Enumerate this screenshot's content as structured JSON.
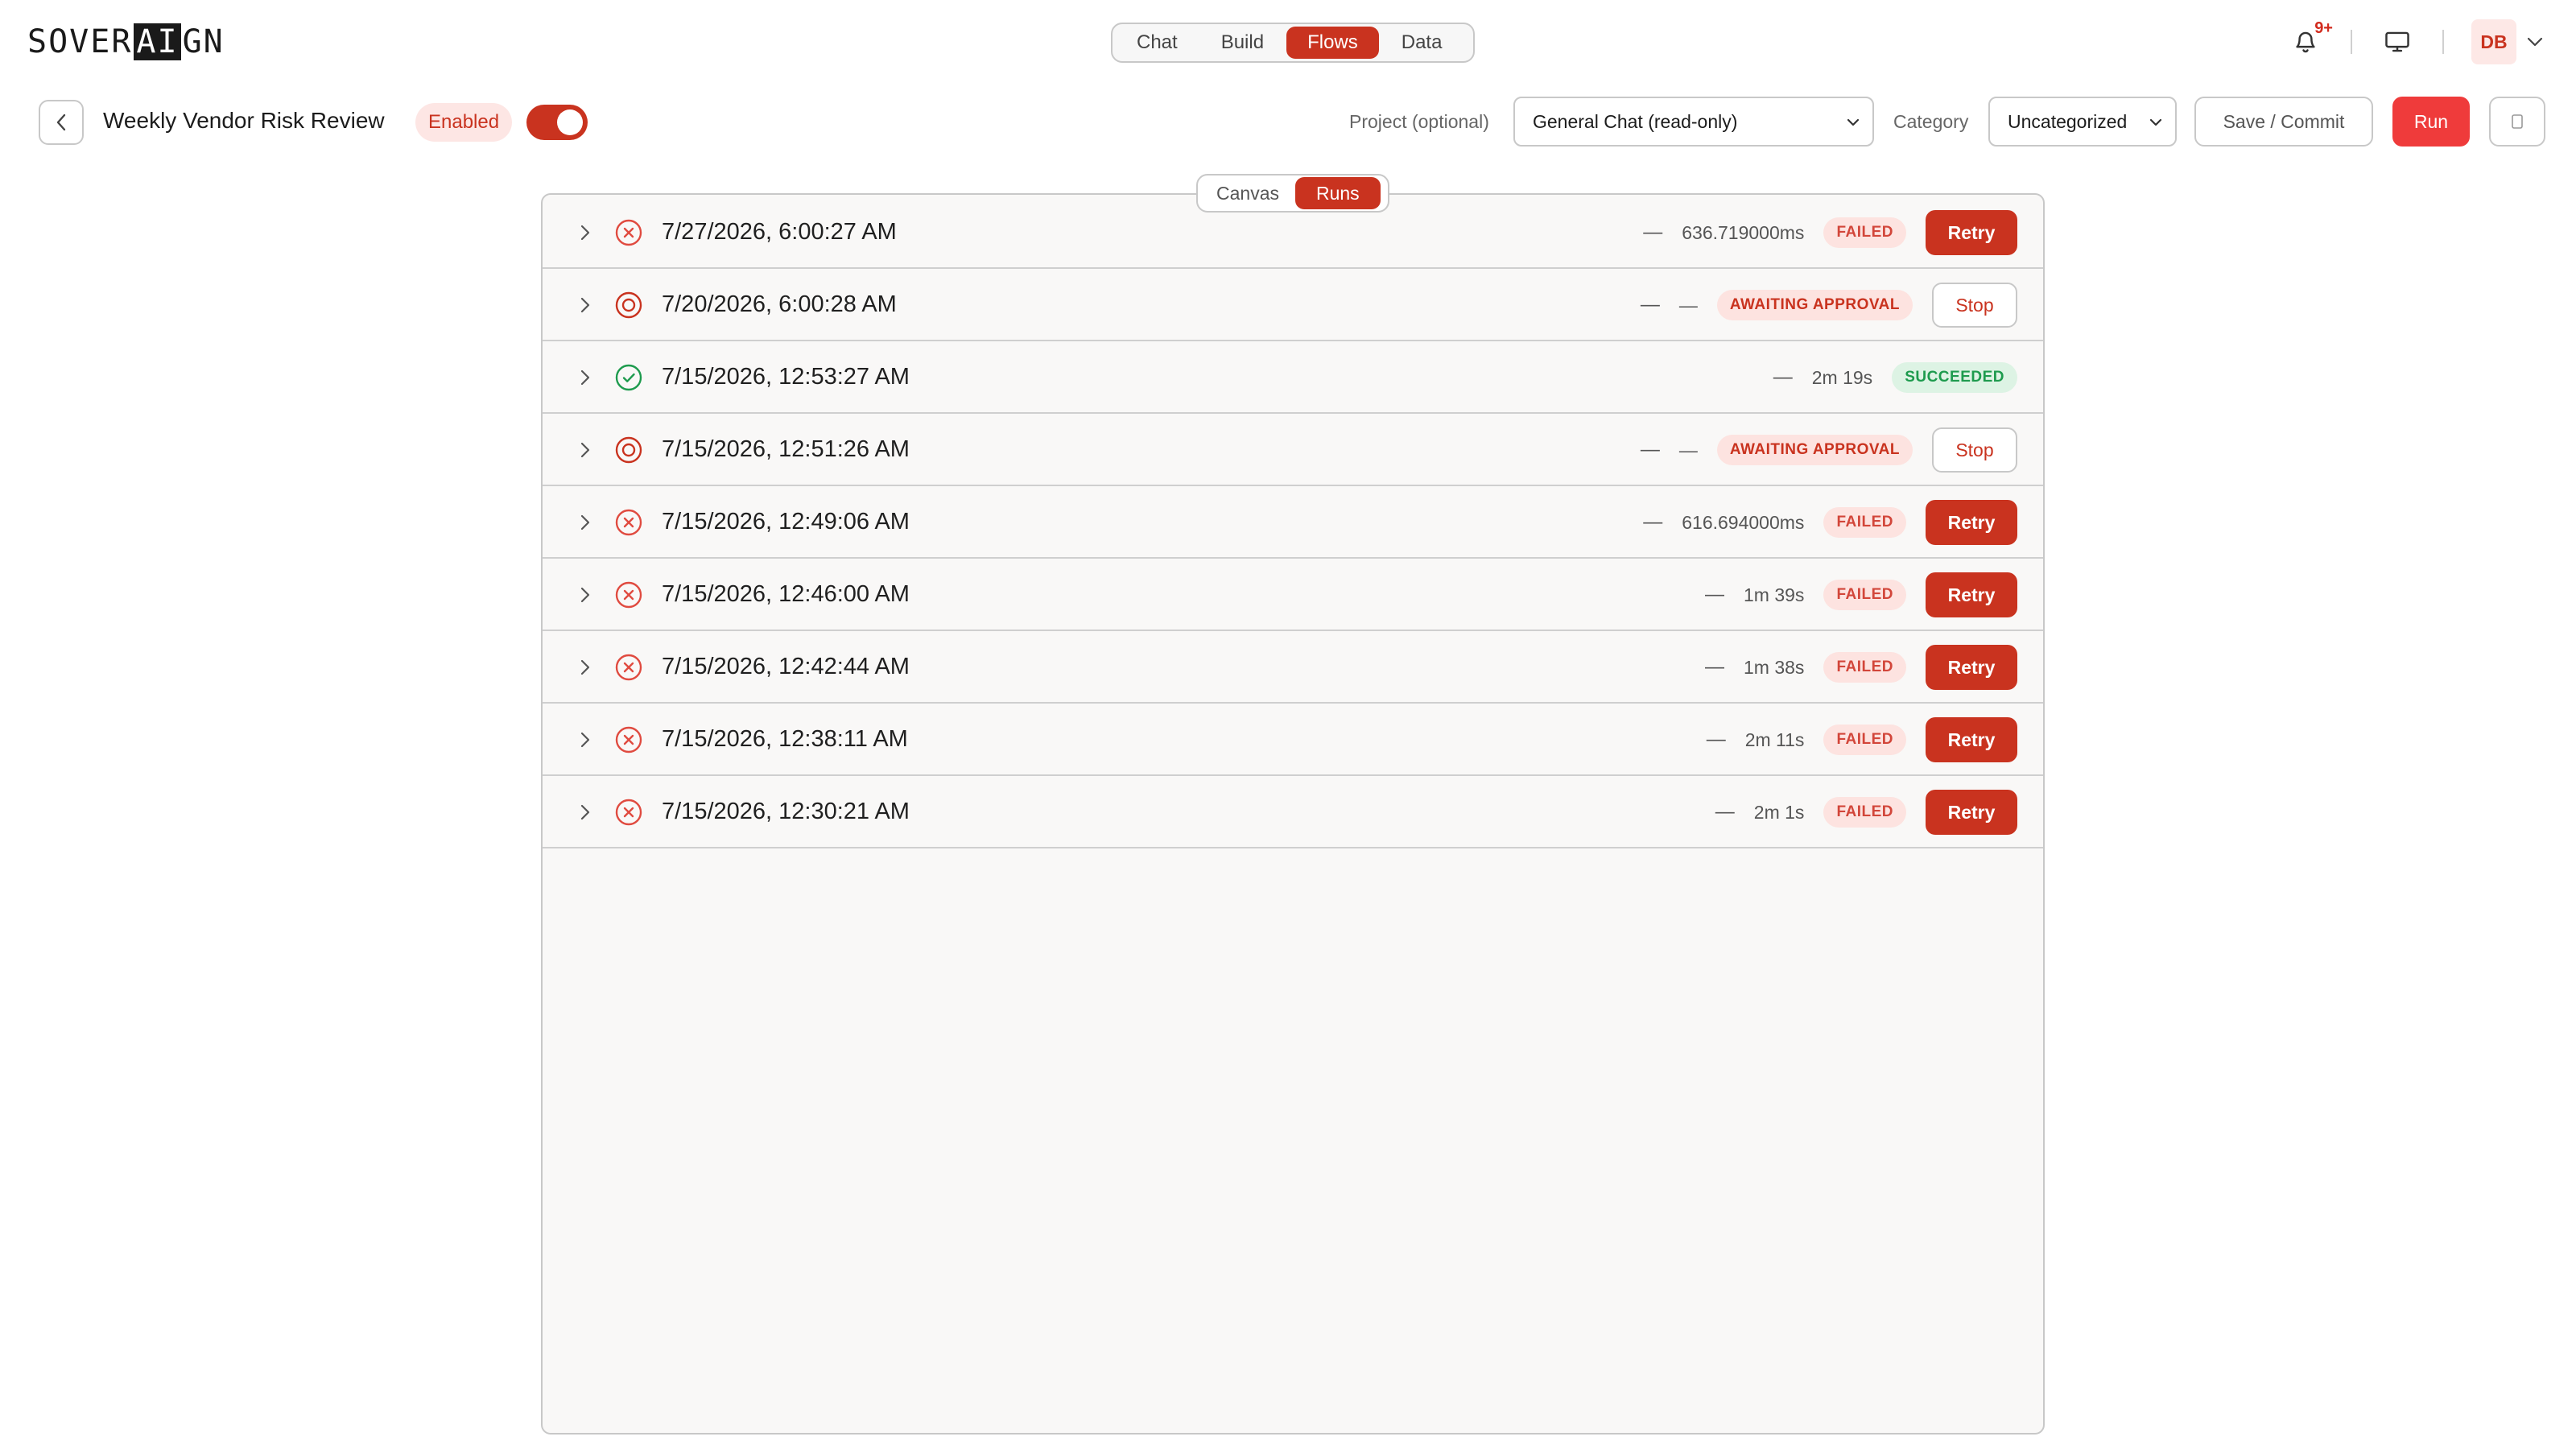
{
  "brand": {
    "logo_pre": "SOVER",
    "logo_ai": "AI",
    "logo_post": "GN"
  },
  "nav": {
    "tabs": [
      {
        "label": "Chat",
        "active": false
      },
      {
        "label": "Build",
        "active": false
      },
      {
        "label": "Flows",
        "active": true
      },
      {
        "label": "Data",
        "active": false
      }
    ]
  },
  "header": {
    "notification_badge": "9+",
    "avatar_initials": "DB"
  },
  "flow": {
    "title": "Weekly Vendor Risk Review",
    "status_label": "Enabled",
    "enabled": true,
    "project_label": "Project (optional)",
    "project_value": "General Chat (read-only)",
    "category_label": "Category",
    "category_value": "Uncategorized",
    "save_label": "Save / Commit",
    "run_label": "Run"
  },
  "view_toggle": {
    "canvas_label": "Canvas",
    "runs_label": "Runs",
    "active": "Runs"
  },
  "colors": {
    "accent": "#c9331f",
    "run_button": "#ef3b3b",
    "failed": "#d2463a",
    "success": "#1e9b4e"
  },
  "runs": [
    {
      "status": "failed",
      "timestamp": "7/27/2026, 6:00:27 AM",
      "dash": "—",
      "duration": "636.719000ms",
      "badge": "FAILED",
      "action": "Retry"
    },
    {
      "status": "awaiting",
      "timestamp": "7/20/2026, 6:00:28 AM",
      "dash": "—",
      "duration": "—",
      "badge": "AWAITING APPROVAL",
      "action": "Stop"
    },
    {
      "status": "succeeded",
      "timestamp": "7/15/2026, 12:53:27 AM",
      "dash": "—",
      "duration": "2m 19s",
      "badge": "SUCCEEDED",
      "action": ""
    },
    {
      "status": "awaiting",
      "timestamp": "7/15/2026, 12:51:26 AM",
      "dash": "—",
      "duration": "—",
      "badge": "AWAITING APPROVAL",
      "action": "Stop"
    },
    {
      "status": "failed",
      "timestamp": "7/15/2026, 12:49:06 AM",
      "dash": "—",
      "duration": "616.694000ms",
      "badge": "FAILED",
      "action": "Retry"
    },
    {
      "status": "failed",
      "timestamp": "7/15/2026, 12:46:00 AM",
      "dash": "—",
      "duration": "1m 39s",
      "badge": "FAILED",
      "action": "Retry"
    },
    {
      "status": "failed",
      "timestamp": "7/15/2026, 12:42:44 AM",
      "dash": "—",
      "duration": "1m 38s",
      "badge": "FAILED",
      "action": "Retry"
    },
    {
      "status": "failed",
      "timestamp": "7/15/2026, 12:38:11 AM",
      "dash": "—",
      "duration": "2m 11s",
      "badge": "FAILED",
      "action": "Retry"
    },
    {
      "status": "failed",
      "timestamp": "7/15/2026, 12:30:21 AM",
      "dash": "—",
      "duration": "2m 1s",
      "badge": "FAILED",
      "action": "Retry"
    }
  ]
}
